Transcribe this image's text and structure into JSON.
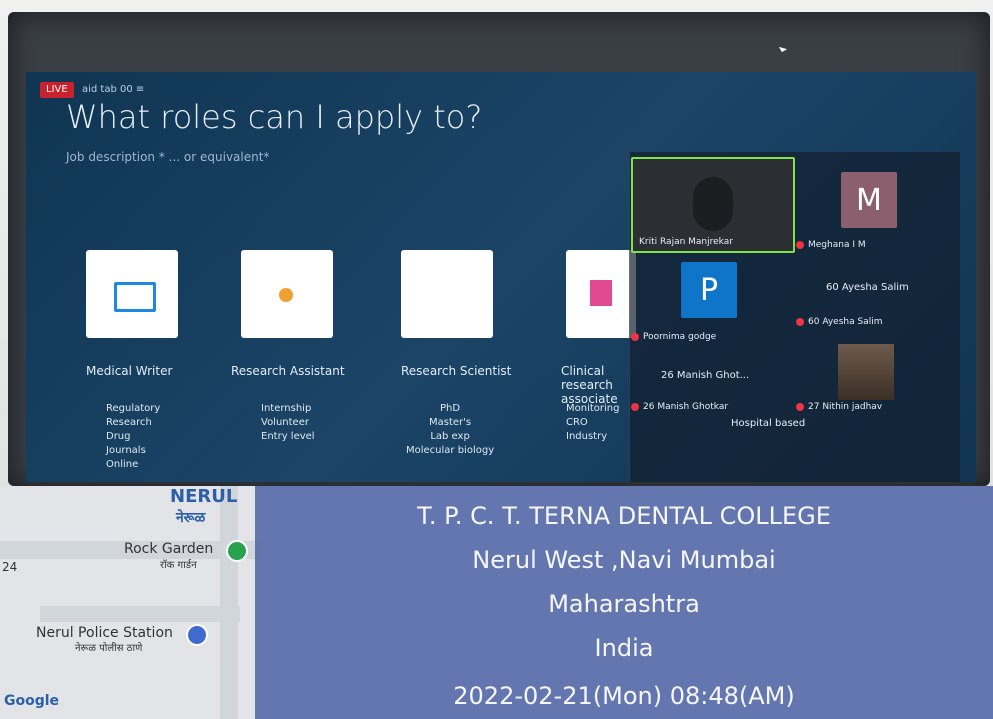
{
  "slide": {
    "live_badge": "LIVE",
    "live_text": "aid tab 00 ≡",
    "title": "What roles can I apply to?",
    "subtitle": "Job description * ... or equivalent*"
  },
  "roles": [
    {
      "title": "Medical Writer",
      "items": [
        "Regulatory",
        "Research",
        "Drug",
        "Journals",
        "Online"
      ]
    },
    {
      "title": "Research Assistant",
      "items": [
        "Internship",
        "Volunteer",
        "Entry level"
      ]
    },
    {
      "title": "Research Scientist",
      "items": [
        "PhD",
        "Master's",
        "Lab exp",
        "Molecular biology"
      ]
    },
    {
      "title": "Clinical research associate",
      "items": [
        "Monitoring",
        "CRO",
        "Industry"
      ]
    }
  ],
  "meeting": {
    "video_name": "Kriti Rajan Manjrekar",
    "participants": [
      {
        "tile": "M",
        "name": "Meghana I M"
      },
      {
        "tile": "P",
        "name": "Poornima godge"
      },
      {
        "tile": "",
        "name": "60 Ayesha Salim",
        "label": "60 Ayesha Salim"
      },
      {
        "tile": "",
        "name": "26 Manish Ghot...",
        "label": "26 Manish Ghot..."
      },
      {
        "tile": "",
        "name": "26 Manish Ghotkar"
      },
      {
        "tile": "",
        "name": "27 Nithin jadhav"
      }
    ],
    "extra": "Hospital based"
  },
  "map": {
    "nerul": "NERUL",
    "nerul_local": "नेरूळ",
    "rock_garden": "Rock Garden",
    "rock_garden_local": "रॉक गार्डन",
    "police": "Nerul Police Station",
    "police_local": "नेरूळ पोलीस ठाणे",
    "google": "Google",
    "distance": "24"
  },
  "banner": {
    "line1": "T. P. C. T. TERNA DENTAL COLLEGE",
    "line2": "Nerul West ,Navi Mumbai",
    "line3": "Maharashtra",
    "line4": "India",
    "datetime": "2022-02-21(Mon)  08:48(AM)"
  },
  "colors": {
    "slide_bg": "#143b5c",
    "banner": "#4c63a5",
    "accent": "#7fe34a"
  }
}
